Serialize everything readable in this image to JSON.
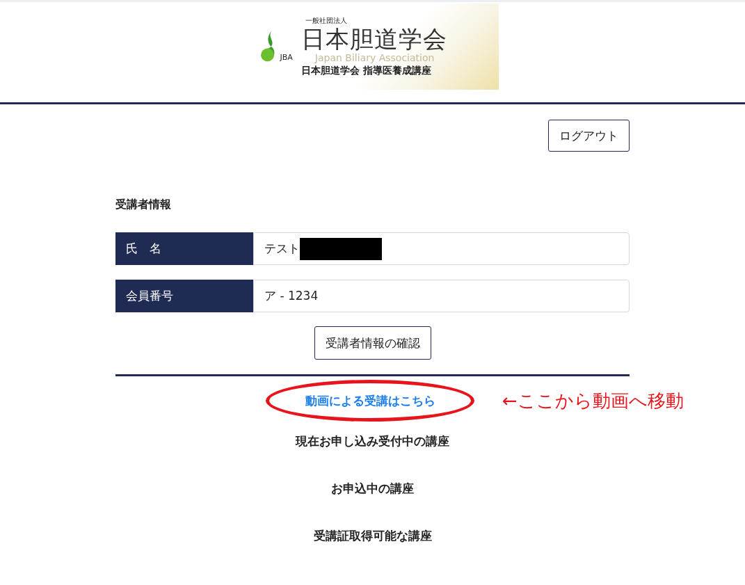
{
  "logo": {
    "org_type": "一般社団法人",
    "name": "日本胆道学会",
    "abbr": "JBA",
    "name_en": "Japan Biliary Association",
    "course": "日本胆道学会 指導医養成講座"
  },
  "logout_button": "ログアウト",
  "section_title": "受講者情報",
  "fields": [
    {
      "label": "氏　名",
      "value": "テスト",
      "redacted": true
    },
    {
      "label": "会員番号",
      "value": "ア - 1234",
      "redacted": false
    }
  ],
  "confirm_button": "受講者情報の確認",
  "video_link": "動画による受講はこちら",
  "annotation": "←ここから動画へ移動",
  "course_headings": [
    "現在お申し込み受付中の講座",
    "お申込中の講座",
    "受講証取得可能な講座"
  ]
}
